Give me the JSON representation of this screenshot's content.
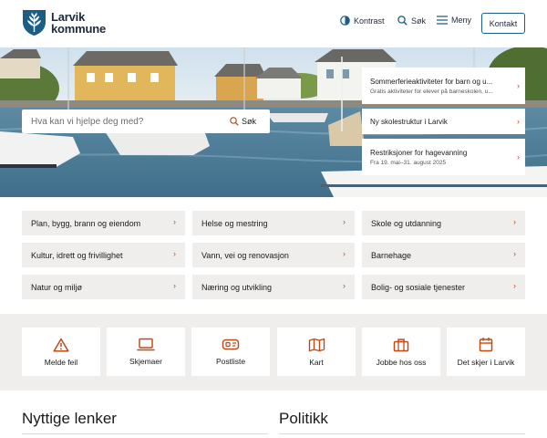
{
  "header": {
    "logo_line1": "Larvik",
    "logo_line2": "kommune",
    "logo_icon": "shield-wheat-icon",
    "contrast_label": "Kontrast",
    "search_label": "Søk",
    "menu_label": "Meny",
    "contact_label": "Kontakt"
  },
  "hero": {
    "search_placeholder": "Hva kan vi hjelpe deg med?",
    "search_button": "Søk",
    "news": [
      {
        "title": "Sommerferieaktiviteter for barn og u...",
        "subtitle": "Gratis aktiviteter for elever på barneskolen, u..."
      },
      {
        "title": "Ny skolestruktur i Larvik",
        "subtitle": ""
      },
      {
        "title": "Restriksjoner for hagevanning",
        "subtitle": "Fra 19. mai–31. august 2025"
      }
    ]
  },
  "categories": [
    "Plan, bygg, brann og eiendom",
    "Helse og mestring",
    "Skole og utdanning",
    "Kultur, idrett og frivillighet",
    "Vann, vei og renovasjon",
    "Barnehage",
    "Natur og miljø",
    "Næring og utvikling",
    "Bolig- og sosiale tjenester"
  ],
  "quick_links": [
    {
      "label": "Melde feil",
      "icon": "warning-icon"
    },
    {
      "label": "Skjemaer",
      "icon": "laptop-icon"
    },
    {
      "label": "Postliste",
      "icon": "mailbox-icon"
    },
    {
      "label": "Kart",
      "icon": "map-icon"
    },
    {
      "label": "Jobbe hos oss",
      "icon": "briefcase-icon"
    },
    {
      "label": "Det skjer i Larvik",
      "icon": "calendar-icon"
    }
  ],
  "sections": {
    "useful_links": "Nyttige lenker",
    "politics": "Politikk"
  },
  "colors": {
    "brand_blue": "#1b5d86",
    "accent_orange": "#c04a17",
    "tile_bg": "#efeeec"
  }
}
